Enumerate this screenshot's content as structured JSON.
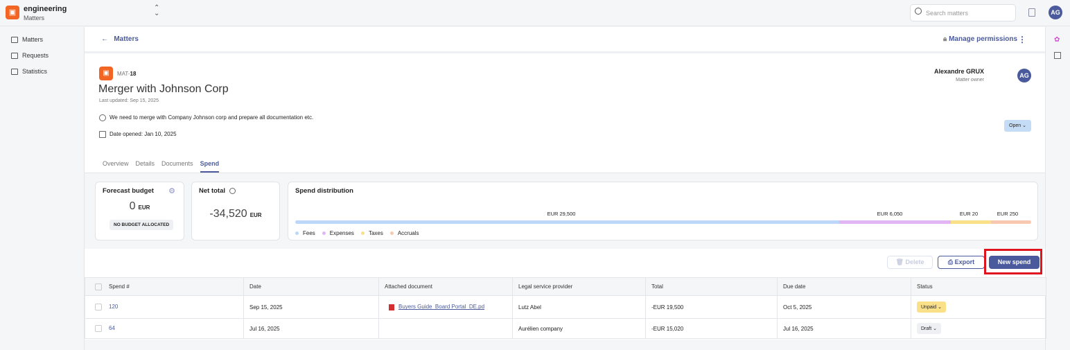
{
  "app": {
    "workspace": "engineering",
    "section": "Matters",
    "search_placeholder": "Search matters",
    "user_initials": "AG"
  },
  "sidebar": {
    "items": [
      {
        "label": "Matters"
      },
      {
        "label": "Requests"
      },
      {
        "label": "Statistics"
      }
    ]
  },
  "header": {
    "back_label": "Matters",
    "manage_permissions": "Manage permissions"
  },
  "matter": {
    "id_prefix": "MAT-",
    "id_number": "18",
    "title": "Merger with Johnson Corp",
    "last_updated": "Last updated: Sep 15, 2025",
    "description": "We need to merge with Company Johnson corp and prepare all documentation etc.",
    "date_opened": "Date opened: Jan 10, 2025",
    "owner_name": "Alexandre GRUX",
    "owner_role": "Matter owner",
    "owner_initials": "AG",
    "status": "Open"
  },
  "tabs": [
    {
      "label": "Overview"
    },
    {
      "label": "Details"
    },
    {
      "label": "Documents"
    },
    {
      "label": "Spend"
    }
  ],
  "forecast": {
    "title": "Forecast budget",
    "value": "0",
    "currency": "EUR",
    "badge": "NO BUDGET ALLOCATED"
  },
  "net_total": {
    "title": "Net total",
    "value": "-34,520",
    "currency": "EUR"
  },
  "distribution": {
    "title": "Spend distribution",
    "segments": [
      {
        "name": "Fees",
        "label": "EUR 29,500",
        "color": "#bcd7f7"
      },
      {
        "name": "Expenses",
        "label": "EUR 6,050",
        "color": "#e2b6f5"
      },
      {
        "name": "Taxes",
        "label": "EUR 20",
        "color": "#fbe08a"
      },
      {
        "name": "Accruals",
        "label": "EUR 250",
        "color": "#f9c8b0"
      }
    ]
  },
  "actions": {
    "delete": "Delete",
    "export": "Export",
    "new_spend": "New spend"
  },
  "table": {
    "headers": [
      "Spend #",
      "Date",
      "Attached document",
      "Legal service provider",
      "Total",
      "Due date",
      "Status"
    ],
    "rows": [
      {
        "spend": "120",
        "date": "Sep 15, 2025",
        "document": "Buyers Guide_Board Portal_DE.pd",
        "provider": "Lutz Abel",
        "total": "-EUR 19,500",
        "due": "Oct 5, 2025",
        "status": "Unpaid"
      },
      {
        "spend": "64",
        "date": "Jul 16, 2025",
        "document": "",
        "provider": "Aurélien company",
        "total": "-EUR 15,020",
        "due": "Jul 16, 2025",
        "status": "Draft"
      }
    ]
  }
}
